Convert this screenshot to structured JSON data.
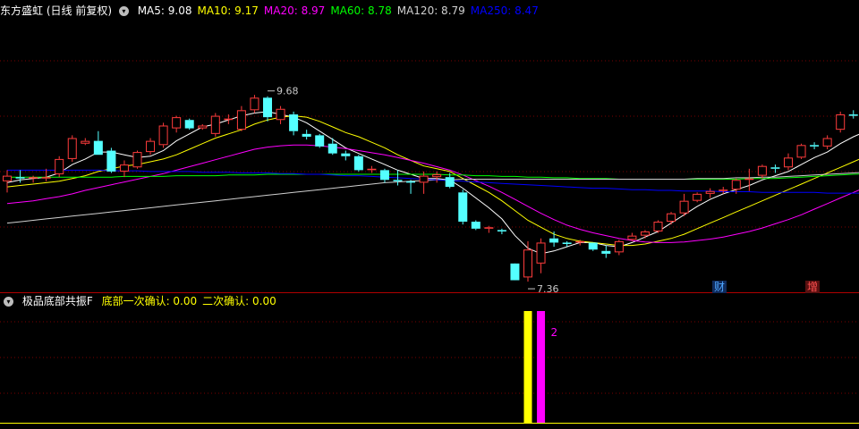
{
  "main_header": {
    "title": "东方盛虹",
    "period": "(日线 前复权)",
    "indicators": [
      {
        "label": "MA5: 9.08",
        "color": "#ffffff"
      },
      {
        "label": "MA10: 9.17",
        "color": "#ffff00"
      },
      {
        "label": "MA20: 8.97",
        "color": "#ff00ff"
      },
      {
        "label": "MA60: 8.78",
        "color": "#00ff00"
      },
      {
        "label": "MA120: 8.79",
        "color": "#d0d0d0"
      },
      {
        "label": "MA250: 8.47",
        "color": "#0000ff"
      }
    ]
  },
  "indicator_header": {
    "title": "极品底部共振F",
    "items": [
      {
        "label": "底部一次确认: 0.00",
        "color": "#ffff00"
      },
      {
        "label": "二次确认: 0.00",
        "color": "#ffff00"
      }
    ]
  },
  "badges": [
    {
      "text": "财",
      "color": "#4ea6ff",
      "bg": "#102a5a"
    },
    {
      "text": "增",
      "color": "#ff5050",
      "bg": "#5a1010"
    }
  ],
  "colors": {
    "up": "#ff3c3c",
    "down": "#54ffff",
    "grid": "#7a0000",
    "divider": "#b00000",
    "annotation": "#c8c8c8"
  },
  "chart_data": [
    {
      "type": "candlestick",
      "title": "东方盛虹",
      "y_range": [
        7.0,
        10.9
      ],
      "annotations": [
        {
          "text": "9.68",
          "index": 20
        },
        {
          "text": "7.36",
          "index": 40
        }
      ],
      "ohlc": [
        [
          8.58,
          8.74,
          8.42,
          8.66
        ],
        [
          8.64,
          8.74,
          8.56,
          8.62
        ],
        [
          8.62,
          8.66,
          8.56,
          8.64
        ],
        [
          8.62,
          8.76,
          8.58,
          8.64
        ],
        [
          8.68,
          8.94,
          8.64,
          8.9
        ],
        [
          8.9,
          9.24,
          8.86,
          9.2
        ],
        [
          9.12,
          9.2,
          9.1,
          9.16
        ],
        [
          9.16,
          9.3,
          8.96,
          8.96
        ],
        [
          9.02,
          9.06,
          8.7,
          8.72
        ],
        [
          8.72,
          8.88,
          8.64,
          8.82
        ],
        [
          8.78,
          9.02,
          8.76,
          9.0
        ],
        [
          9.0,
          9.2,
          8.96,
          9.16
        ],
        [
          9.1,
          9.42,
          9.06,
          9.38
        ],
        [
          9.34,
          9.52,
          9.28,
          9.5
        ],
        [
          9.46,
          9.48,
          9.32,
          9.34
        ],
        [
          9.34,
          9.4,
          9.32,
          9.38
        ],
        [
          9.26,
          9.56,
          9.22,
          9.52
        ],
        [
          9.46,
          9.54,
          9.4,
          9.48
        ],
        [
          9.32,
          9.66,
          9.3,
          9.6
        ],
        [
          9.6,
          9.82,
          9.56,
          9.78
        ],
        [
          9.78,
          9.8,
          9.44,
          9.5
        ],
        [
          9.46,
          9.66,
          9.4,
          9.62
        ],
        [
          9.54,
          9.58,
          9.24,
          9.3
        ],
        [
          9.26,
          9.32,
          9.18,
          9.22
        ],
        [
          9.24,
          9.26,
          9.06,
          9.08
        ],
        [
          9.12,
          9.2,
          8.96,
          8.98
        ],
        [
          8.98,
          9.02,
          8.88,
          8.94
        ],
        [
          8.94,
          8.96,
          8.72,
          8.74
        ],
        [
          8.74,
          8.8,
          8.7,
          8.76
        ],
        [
          8.74,
          8.76,
          8.56,
          8.6
        ],
        [
          8.6,
          8.74,
          8.52,
          8.58
        ],
        [
          8.58,
          8.6,
          8.4,
          8.56
        ],
        [
          8.56,
          8.72,
          8.4,
          8.66
        ],
        [
          8.64,
          8.72,
          8.56,
          8.68
        ],
        [
          8.64,
          8.7,
          8.48,
          8.5
        ],
        [
          8.42,
          8.46,
          7.96,
          8.0
        ],
        [
          8.0,
          8.02,
          7.88,
          7.9
        ],
        [
          7.9,
          7.94,
          7.84,
          7.92
        ],
        [
          7.88,
          7.9,
          7.82,
          7.86
        ],
        [
          7.4,
          7.38,
          7.28,
          7.16
        ],
        [
          7.2,
          7.72,
          7.14,
          7.6
        ],
        [
          7.4,
          7.76,
          7.26,
          7.7
        ],
        [
          7.76,
          7.86,
          7.64,
          7.7
        ],
        [
          7.7,
          7.72,
          7.64,
          7.68
        ],
        [
          7.7,
          7.74,
          7.66,
          7.72
        ],
        [
          7.7,
          7.7,
          7.58,
          7.6
        ],
        [
          7.58,
          7.66,
          7.48,
          7.54
        ],
        [
          7.56,
          7.74,
          7.52,
          7.72
        ],
        [
          7.74,
          7.84,
          7.72,
          7.8
        ],
        [
          7.8,
          7.88,
          7.76,
          7.86
        ],
        [
          7.86,
          8.02,
          7.84,
          8.0
        ],
        [
          8.0,
          8.14,
          7.96,
          8.12
        ],
        [
          8.12,
          8.4,
          8.08,
          8.3
        ],
        [
          8.3,
          8.42,
          8.28,
          8.4
        ],
        [
          8.4,
          8.48,
          8.34,
          8.44
        ],
        [
          8.44,
          8.5,
          8.4,
          8.46
        ],
        [
          8.46,
          8.62,
          8.4,
          8.6
        ],
        [
          8.6,
          8.76,
          8.44,
          8.62
        ],
        [
          8.66,
          8.82,
          8.62,
          8.8
        ],
        [
          8.78,
          8.82,
          8.7,
          8.76
        ],
        [
          8.78,
          8.98,
          8.74,
          8.92
        ],
        [
          8.92,
          9.12,
          8.9,
          9.1
        ],
        [
          9.1,
          9.14,
          9.04,
          9.08
        ],
        [
          9.08,
          9.24,
          9.04,
          9.2
        ],
        [
          9.32,
          9.58,
          9.28,
          9.54
        ],
        [
          9.54,
          9.6,
          9.48,
          9.52
        ],
        [
          9.52,
          9.58,
          9.3,
          9.38
        ],
        [
          9.34,
          9.4,
          9.14,
          9.18
        ],
        [
          9.2,
          9.28,
          9.04,
          9.1
        ]
      ],
      "series": [
        {
          "name": "MA5",
          "color": "#ffffff",
          "values": [
            8.56,
            8.6,
            8.62,
            8.64,
            8.7,
            8.82,
            8.9,
            9.0,
            9.0,
            8.96,
            8.92,
            8.94,
            9.02,
            9.16,
            9.26,
            9.36,
            9.4,
            9.46,
            9.52,
            9.56,
            9.58,
            9.54,
            9.5,
            9.42,
            9.3,
            9.18,
            9.06,
            8.98,
            8.9,
            8.82,
            8.74,
            8.68,
            8.62,
            8.62,
            8.6,
            8.48,
            8.34,
            8.2,
            8.04,
            7.8,
            7.62,
            7.54,
            7.58,
            7.64,
            7.7,
            7.7,
            7.66,
            7.64,
            7.7,
            7.78,
            7.86,
            7.98,
            8.1,
            8.22,
            8.32,
            8.4,
            8.46,
            8.52,
            8.6,
            8.66,
            8.72,
            8.82,
            8.92,
            9.0,
            9.12,
            9.22,
            9.3,
            9.34,
            9.34
          ]
        },
        {
          "name": "MA10",
          "color": "#ffff00",
          "values": [
            8.5,
            8.52,
            8.54,
            8.56,
            8.58,
            8.62,
            8.66,
            8.72,
            8.76,
            8.8,
            8.82,
            8.86,
            8.9,
            8.96,
            9.04,
            9.12,
            9.2,
            9.26,
            9.32,
            9.4,
            9.46,
            9.5,
            9.52,
            9.5,
            9.44,
            9.36,
            9.28,
            9.22,
            9.14,
            9.06,
            8.96,
            8.88,
            8.8,
            8.76,
            8.72,
            8.62,
            8.52,
            8.42,
            8.3,
            8.16,
            8.02,
            7.92,
            7.82,
            7.76,
            7.72,
            7.7,
            7.68,
            7.66,
            7.66,
            7.68,
            7.72,
            7.76,
            7.82,
            7.9,
            7.98,
            8.06,
            8.14,
            8.22,
            8.3,
            8.38,
            8.46,
            8.54,
            8.62,
            8.7,
            8.78,
            8.86,
            8.94,
            9.0,
            9.04
          ]
        },
        {
          "name": "MA20",
          "color": "#ff00ff",
          "values": [
            8.26,
            8.28,
            8.3,
            8.33,
            8.36,
            8.4,
            8.45,
            8.49,
            8.53,
            8.57,
            8.61,
            8.65,
            8.69,
            8.74,
            8.79,
            8.84,
            8.89,
            8.94,
            8.99,
            9.04,
            9.07,
            9.09,
            9.1,
            9.1,
            9.09,
            9.07,
            9.05,
            9.02,
            8.99,
            8.96,
            8.92,
            8.88,
            8.84,
            8.79,
            8.74,
            8.67,
            8.59,
            8.51,
            8.42,
            8.32,
            8.22,
            8.12,
            8.03,
            7.95,
            7.89,
            7.84,
            7.8,
            7.76,
            7.73,
            7.71,
            7.7,
            7.7,
            7.71,
            7.73,
            7.75,
            7.78,
            7.82,
            7.86,
            7.91,
            7.97,
            8.03,
            8.1,
            8.18,
            8.26,
            8.34,
            8.42,
            8.5,
            8.57,
            8.64
          ]
        },
        {
          "name": "MA60",
          "color": "#00ff00",
          "values": [
            8.64,
            8.64,
            8.64,
            8.64,
            8.64,
            8.64,
            8.64,
            8.64,
            8.64,
            8.65,
            8.65,
            8.65,
            8.65,
            8.66,
            8.66,
            8.66,
            8.66,
            8.67,
            8.67,
            8.67,
            8.68,
            8.68,
            8.68,
            8.68,
            8.68,
            8.68,
            8.68,
            8.68,
            8.68,
            8.68,
            8.68,
            8.68,
            8.68,
            8.68,
            8.67,
            8.67,
            8.66,
            8.66,
            8.65,
            8.65,
            8.64,
            8.64,
            8.63,
            8.63,
            8.62,
            8.62,
            8.62,
            8.61,
            8.61,
            8.61,
            8.61,
            8.61,
            8.61,
            8.61,
            8.61,
            8.61,
            8.61,
            8.62,
            8.62,
            8.62,
            8.63,
            8.64,
            8.65,
            8.66,
            8.67,
            8.68,
            8.69,
            8.7,
            8.7
          ]
        },
        {
          "name": "MA120",
          "color": "#d0d0d0",
          "values": [
            7.98,
            8.0,
            8.02,
            8.04,
            8.06,
            8.08,
            8.1,
            8.12,
            8.14,
            8.16,
            8.18,
            8.2,
            8.22,
            8.24,
            8.26,
            8.28,
            8.3,
            8.32,
            8.34,
            8.36,
            8.38,
            8.4,
            8.42,
            8.44,
            8.46,
            8.48,
            8.5,
            8.52,
            8.54,
            8.56,
            8.57,
            8.58,
            8.59,
            8.6,
            8.6,
            8.61,
            8.61,
            8.61,
            8.61,
            8.61,
            8.61,
            8.61,
            8.61,
            8.61,
            8.61,
            8.61,
            8.61,
            8.61,
            8.61,
            8.61,
            8.61,
            8.61,
            8.61,
            8.62,
            8.62,
            8.62,
            8.63,
            8.63,
            8.64,
            8.64,
            8.65,
            8.66,
            8.67,
            8.68,
            8.69,
            8.7,
            8.71,
            8.72,
            8.72
          ]
        },
        {
          "name": "MA250",
          "color": "#0000ff",
          "values": [
            8.74,
            8.74,
            8.74,
            8.74,
            8.74,
            8.74,
            8.74,
            8.74,
            8.73,
            8.73,
            8.73,
            8.72,
            8.72,
            8.72,
            8.72,
            8.71,
            8.71,
            8.71,
            8.7,
            8.7,
            8.7,
            8.69,
            8.69,
            8.68,
            8.68,
            8.67,
            8.66,
            8.66,
            8.65,
            8.64,
            8.63,
            8.62,
            8.61,
            8.6,
            8.59,
            8.58,
            8.57,
            8.56,
            8.55,
            8.54,
            8.53,
            8.52,
            8.51,
            8.5,
            8.49,
            8.48,
            8.48,
            8.47,
            8.46,
            8.46,
            8.45,
            8.45,
            8.44,
            8.44,
            8.44,
            8.43,
            8.43,
            8.43,
            8.42,
            8.42,
            8.42,
            8.42,
            8.42,
            8.41,
            8.41,
            8.41,
            8.41,
            8.4,
            8.4
          ]
        }
      ]
    },
    {
      "type": "bar",
      "title": "极品底部共振F",
      "y_range": [
        0,
        2
      ],
      "annotations": [
        {
          "text": "2",
          "index": 41
        }
      ],
      "bars": [
        {
          "index": 40,
          "value": 2,
          "color": "#ffff00"
        },
        {
          "index": 41,
          "value": 2,
          "color": "#ff00ff"
        }
      ]
    }
  ]
}
